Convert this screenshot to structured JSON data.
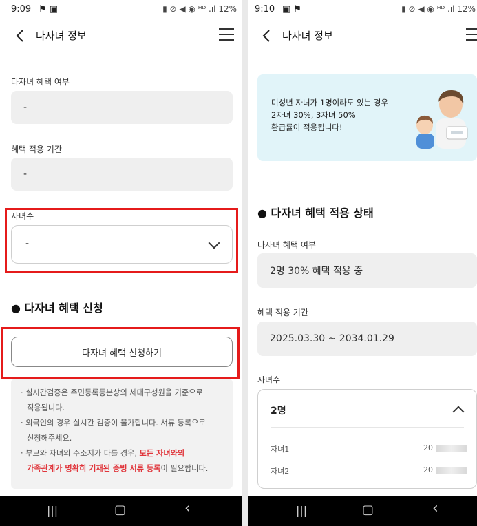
{
  "left": {
    "status": {
      "time": "9:09",
      "icons": "⚑ ▣",
      "right": "▮ ⊘ ◀ ◉ ᴴᴰ .ıl 12%"
    },
    "header": {
      "title": "다자녀 정보"
    },
    "benefit_status": {
      "label": "다자녀 혜택 여부",
      "value": "-"
    },
    "benefit_period": {
      "label": "혜택 적용 기간",
      "value": "-"
    },
    "children": {
      "label": "자녀수",
      "value": "-"
    },
    "apply_section": {
      "title": "● 다자녀 혜택 신청",
      "button": "다자녀 혜택 신청하기"
    },
    "notice": {
      "line1": "· 실시간검증은 주민등록등본상의 세대구성원을 기준으로",
      "line1b": "적용됩니다.",
      "line2": "· 외국인의 경우 실시간 검증이 불가합니다. 서류 등록으로",
      "line2b": "신청해주세요.",
      "line3a": "· 부모와 자녀의 주소지가 다를 경우, ",
      "line3red1": "모든 자녀와의",
      "line3red2": "가족관계가 명확히 기재된 증빙 서류 등록",
      "line3end": "이 필요합니다."
    },
    "nav": {
      "recent": "|||",
      "home": "▢",
      "back": "‹"
    }
  },
  "right": {
    "status": {
      "time": "9:10",
      "icons": "▣ ⚑",
      "right": "▮ ⊘ ◀ ◉ ᴴᴰ .ıl 12%"
    },
    "header": {
      "title": "다자녀 정보"
    },
    "banner": {
      "line1": "미성년 자녀가 1명이라도 있는 경우",
      "line2": "2자녀 30%, 3자녀 50%",
      "line3": "환급률이 적용됩니다!"
    },
    "status_section": {
      "title": "● 다자녀 혜택 적용 상태"
    },
    "benefit_status": {
      "label": "다자녀 혜택 여부",
      "value": "2명 30% 혜택 적용 중"
    },
    "benefit_period": {
      "label": "혜택 적용 기간",
      "value": "2025.03.30 ~ 2034.01.29"
    },
    "children": {
      "label": "자녀수",
      "value": "2명",
      "rows": [
        {
          "name": "자녀1",
          "birth": "20"
        },
        {
          "name": "자녀2",
          "birth": "20"
        }
      ]
    },
    "nav": {
      "recent": "|||",
      "home": "▢",
      "back": "‹"
    }
  },
  "colors": {
    "highlight": "#e51b1b",
    "banner_bg": "#e1f4f9",
    "field_bg": "#efefef",
    "notice_red": "#e0353b"
  }
}
